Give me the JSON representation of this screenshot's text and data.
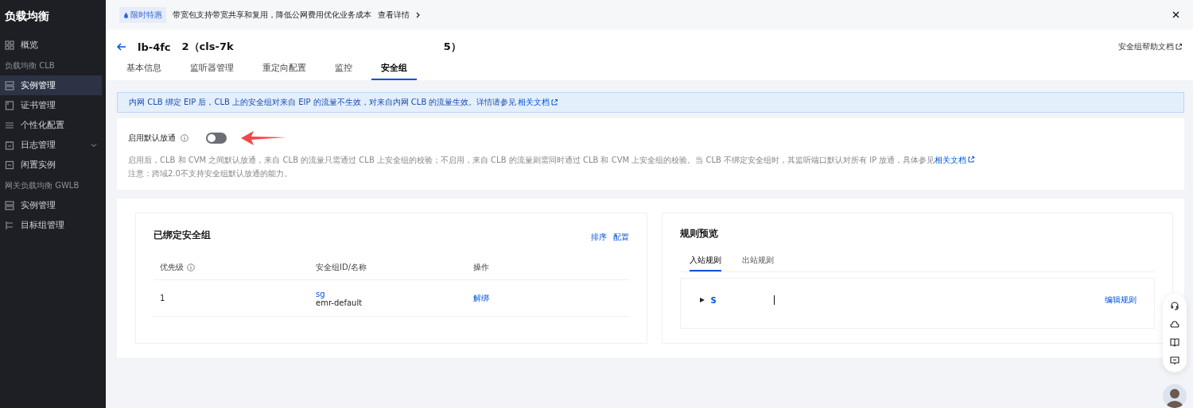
{
  "sidebar": {
    "title": "负载均衡",
    "items": [
      {
        "kind": "item",
        "label": "概览",
        "selected": false
      },
      {
        "kind": "section",
        "label": "负载均衡 CLB"
      },
      {
        "kind": "item",
        "label": "实例管理",
        "selected": true
      },
      {
        "kind": "item",
        "label": "证书管理",
        "selected": false
      },
      {
        "kind": "item",
        "label": "个性化配置",
        "selected": false
      },
      {
        "kind": "item",
        "label": "日志管理",
        "selected": false,
        "expanded": false
      },
      {
        "kind": "item",
        "label": "闲置实例",
        "selected": false
      },
      {
        "kind": "section",
        "label": "网关负载均衡 GWLB"
      },
      {
        "kind": "item",
        "label": "实例管理",
        "selected": false
      },
      {
        "kind": "item",
        "label": "目标组管理",
        "selected": false
      }
    ]
  },
  "promo": {
    "badge": "限时特惠",
    "text": "带宽包支持带宽共享和复用，降低公网费用优化业务成本",
    "link": "查看详情"
  },
  "header": {
    "title_parts": [
      "lb-4fc",
      "2（cls-7k",
      "5）"
    ],
    "help_link": "安全组帮助文档"
  },
  "tabs": [
    {
      "label": "基本信息",
      "selected": false
    },
    {
      "label": "监听器管理",
      "selected": false
    },
    {
      "label": "重定向配置",
      "selected": false
    },
    {
      "label": "监控",
      "selected": false
    },
    {
      "label": "安全组",
      "selected": true
    }
  ],
  "notice": {
    "text": "内网 CLB 绑定 EIP 后，CLB 上的安全组对来自 EIP 的流量不生效，对来自内网 CLB 的流量生效。详情请参见",
    "link": "相关文档"
  },
  "default_allow": {
    "label": "启用默认放通",
    "on": false,
    "description": "启用后，CLB 和 CVM 之间默认放通，来自 CLB 的流量只需通过 CLB 上安全组的校验；不启用，来自 CLB 的流量则需同时通过 CLB 和 CVM 上安全组的校验。当 CLB 不绑定安全组时，其监听端口默认对所有 IP 放通，具体参见",
    "link": "相关文档",
    "note": "注意：跨域2.0不支持安全组默认放通的能力。"
  },
  "bound_groups": {
    "title": "已绑定安全组",
    "actions": [
      "排序",
      "配置"
    ],
    "columns": [
      "优先级",
      "安全组ID/名称",
      "操作"
    ],
    "rows": [
      {
        "priority": "1",
        "id": "sg",
        "name": "emr-default",
        "action": "解绑"
      }
    ]
  },
  "rules_preview": {
    "title": "规则预览",
    "tabs": [
      {
        "label": "入站规则",
        "selected": true
      },
      {
        "label": "出站规则",
        "selected": false
      }
    ],
    "rules": [
      {
        "name": "S",
        "expanded": false,
        "action": "编辑规则"
      }
    ]
  }
}
